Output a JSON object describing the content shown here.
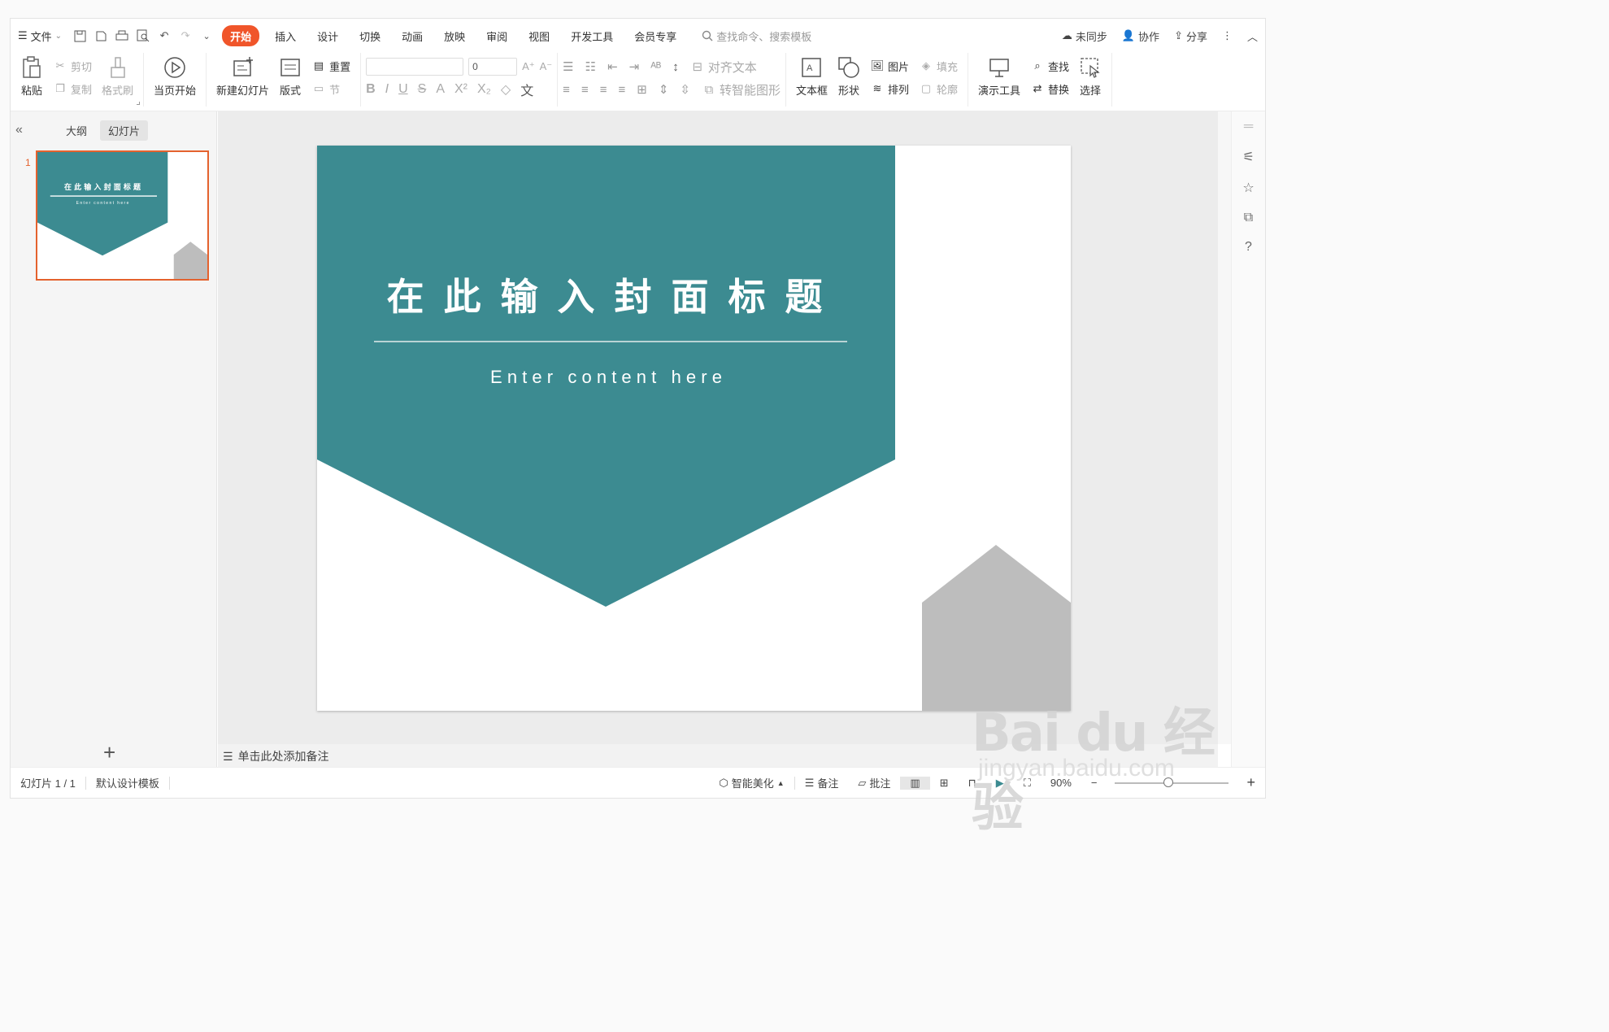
{
  "menu": {
    "file": "文件",
    "tabs": [
      "插入",
      "设计",
      "切换",
      "动画",
      "放映",
      "审阅",
      "视图",
      "开发工具",
      "会员专享"
    ],
    "active_tab": "开始",
    "search_placeholder": "查找命令、搜索模板",
    "right": {
      "sync": "未同步",
      "collab": "协作",
      "share": "分享"
    }
  },
  "ribbon": {
    "paste": "粘贴",
    "cut": "剪切",
    "copy": "复制",
    "format_painter": "格式刷",
    "start_current": "当页开始",
    "new_slide": "新建幻灯片",
    "layout": "版式",
    "reset": "重置",
    "section": "节",
    "font_size": "0",
    "align_text": "对齐文本",
    "smart_art": "转智能图形",
    "textbox": "文本框",
    "shape": "形状",
    "picture": "图片",
    "arrange": "排列",
    "fill": "填充",
    "outline": "轮廓",
    "present_tools": "演示工具",
    "find": "查找",
    "replace": "替换",
    "select": "选择"
  },
  "left_panel": {
    "tab_outline": "大纲",
    "tab_slides": "幻灯片",
    "slide_number": "1"
  },
  "slide": {
    "title": "在 此 输 入 封 面 标 题",
    "subtitle": "E n t e r   c o n t e n t   h e r e",
    "thumb_title": "在 此 输 入 封 面 标 题",
    "thumb_subtitle": "E n t e r   c o n t e n t   h e r e",
    "teal": "#3c8b91",
    "gray": "#bdbdbd"
  },
  "notes_placeholder": "单击此处添加备注",
  "status": {
    "slide_count": "幻灯片 1 / 1",
    "template": "默认设计模板",
    "beautify": "智能美化",
    "notes": "备注",
    "comments": "批注",
    "zoom": "90%"
  },
  "watermark": {
    "logo": "Bai du 经验",
    "url": "jingyan.baidu.com"
  }
}
